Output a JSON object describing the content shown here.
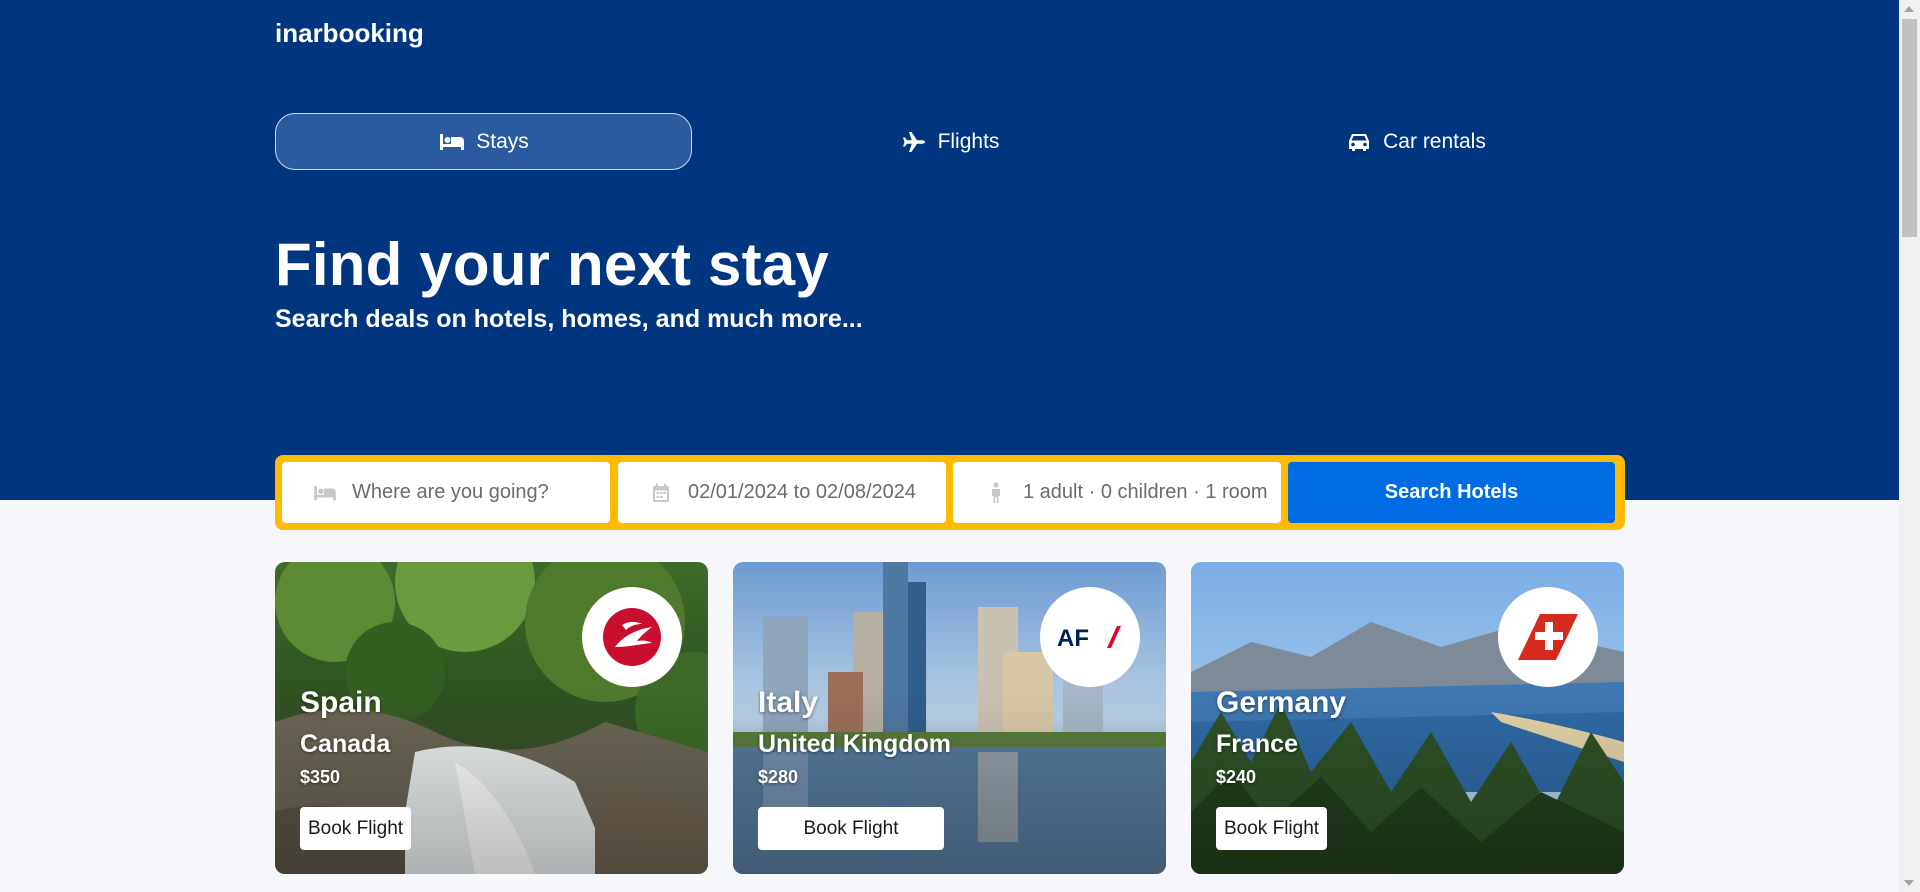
{
  "brand": {
    "name": "inarbooking"
  },
  "tabs": [
    {
      "label": "Stays",
      "icon": "bed-icon",
      "active": true
    },
    {
      "label": "Flights",
      "icon": "plane-icon",
      "active": false
    },
    {
      "label": "Car rentals",
      "icon": "car-icon",
      "active": false
    }
  ],
  "hero": {
    "title": "Find your next stay",
    "subtitle": "Search deals on hotels, homes, and much more..."
  },
  "search": {
    "destination_placeholder": "Where are you going?",
    "dates": "02/01/2024 to 02/08/2024",
    "guests": "1 adult · 0 children · 1 room",
    "button_label": "Search Hotels"
  },
  "deals": [
    {
      "from": "Spain",
      "to": "Canada",
      "price": "$350",
      "button": "Book Flight",
      "airline_logo": "turkish-airlines-logo"
    },
    {
      "from": "Italy",
      "to": "United Kingdom",
      "price": "$280",
      "button": "Book Flight",
      "airline_logo": "air-france-logo",
      "airline_text": "AF"
    },
    {
      "from": "Germany",
      "to": "France",
      "price": "$240",
      "button": "Book Flight",
      "airline_logo": "swiss-logo"
    }
  ],
  "colors": {
    "brand_blue": "#003580",
    "accent_yellow": "#febb02",
    "button_blue": "#006ce4",
    "page_bg": "#f5f7fa"
  }
}
